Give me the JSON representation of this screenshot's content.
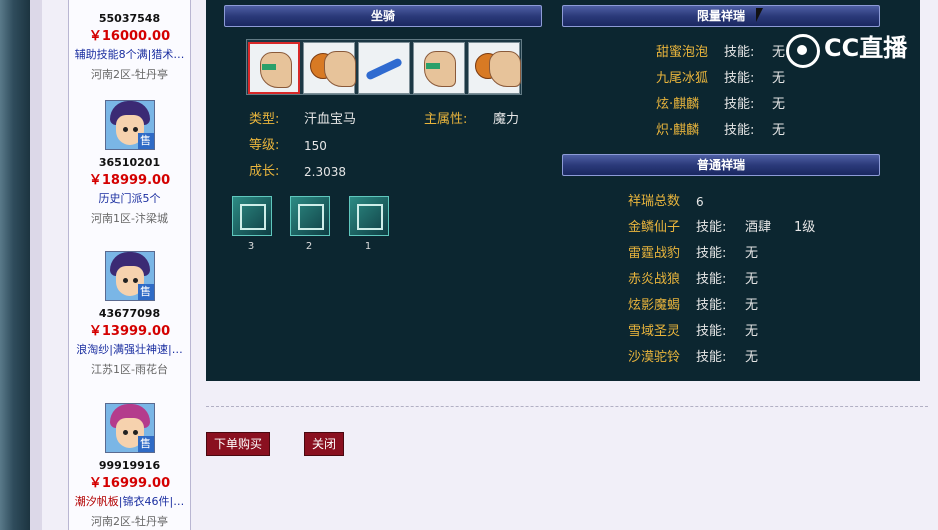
{
  "sidebar": {
    "sellers": [
      {
        "id": "55037548",
        "price": "￥16000.00",
        "desc": "辅助技能8个满|猎术…",
        "server": "河南2区-牡丹亭",
        "hair": "none"
      },
      {
        "id": "36510201",
        "price": "￥18999.00",
        "desc": "历史门派5个",
        "server": "河南1区-汴梁城",
        "hair": "purple",
        "tag": "售"
      },
      {
        "id": "43677098",
        "price": "￥13999.00",
        "desc": "浪淘纱|满强壮神速|…",
        "server": "江苏1区-雨花台",
        "hair": "purple",
        "tag": "售"
      },
      {
        "id": "99919916",
        "price": "￥16999.00",
        "desc_a": "潮汐帆板",
        "desc_b": "|锦衣46件|…",
        "server": "河南2区-牡丹亭",
        "hair": "pink",
        "tag": "售"
      }
    ]
  },
  "mount": {
    "header": "坐骑",
    "type_label": "类型:",
    "type_value": "汗血宝马",
    "main_attr_label": "主属性:",
    "main_attr_value": "魔力",
    "level_label": "等级:",
    "level_value": "150",
    "growth_label": "成长:",
    "growth_value": "2.3038",
    "skills": [
      {
        "count": "3"
      },
      {
        "count": "2"
      },
      {
        "count": "1"
      }
    ]
  },
  "limited": {
    "header": "限量祥瑞",
    "items": [
      {
        "name": "甜蜜泡泡",
        "label": "技能:",
        "value": "无"
      },
      {
        "name": "九尾冰狐",
        "label": "技能:",
        "value": "无"
      },
      {
        "name": "炫·麒麟",
        "label": "技能:",
        "value": "无"
      },
      {
        "name": "炽·麒麟",
        "label": "技能:",
        "value": "无"
      }
    ]
  },
  "normal": {
    "header": "普通祥瑞",
    "total_label": "祥瑞总数",
    "total_value": "6",
    "items": [
      {
        "name": "金鳞仙子",
        "label": "技能:",
        "value": "酒肆",
        "extra": "1级"
      },
      {
        "name": "雷霆战豹",
        "label": "技能:",
        "value": "无"
      },
      {
        "name": "赤炎战狼",
        "label": "技能:",
        "value": "无"
      },
      {
        "name": "炫影魔蝎",
        "label": "技能:",
        "value": "无"
      },
      {
        "name": "雪域圣灵",
        "label": "技能:",
        "value": "无"
      },
      {
        "name": "沙漠驼铃",
        "label": "技能:",
        "value": "无"
      }
    ]
  },
  "actions": {
    "order": "下单购买",
    "close": "关闭"
  },
  "watermark": {
    "text": "CC直播"
  }
}
